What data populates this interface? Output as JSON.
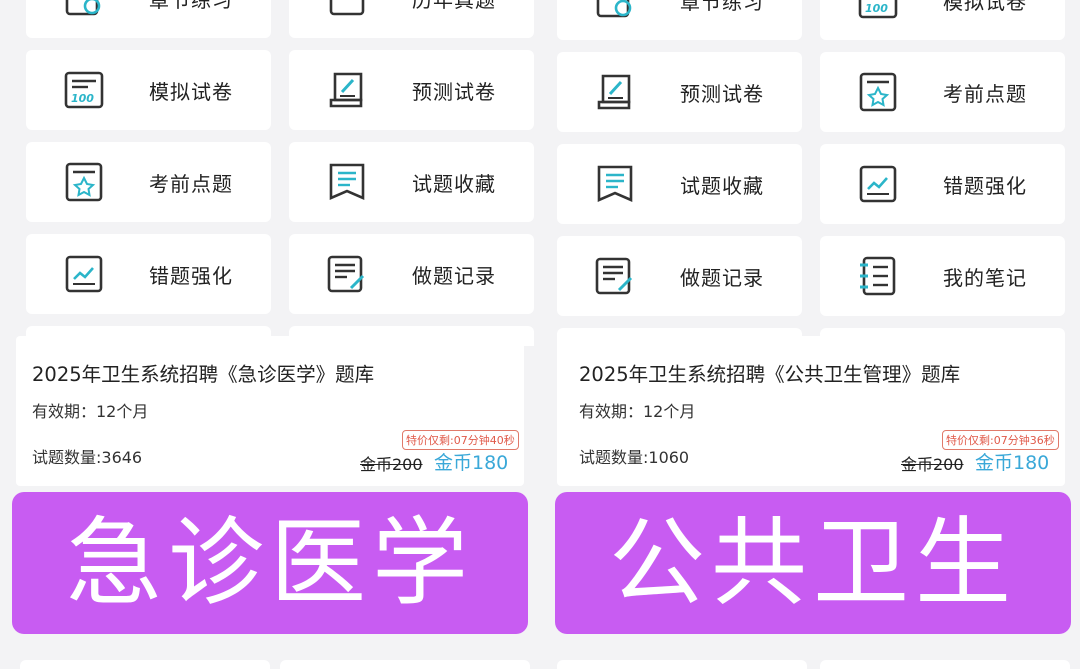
{
  "left": {
    "tiles": [
      {
        "label": "章节练习",
        "icon": "chapter-practice-icon"
      },
      {
        "label": "历年真题",
        "icon": "past-exams-icon"
      },
      {
        "label": "模拟试卷",
        "icon": "mock-exam-icon"
      },
      {
        "label": "预测试卷",
        "icon": "predicted-exam-icon"
      },
      {
        "label": "考前点题",
        "icon": "pre-exam-tips-icon"
      },
      {
        "label": "试题收藏",
        "icon": "favorites-icon"
      },
      {
        "label": "错题强化",
        "icon": "wrong-questions-icon"
      },
      {
        "label": "做题记录",
        "icon": "practice-record-icon"
      }
    ],
    "card": {
      "title": "2025年卫生系统招聘《急诊医学》题库",
      "validity": "有效期：12个月",
      "count": "试题数量:3646",
      "countdown": "特价仅剩:07分钟40秒",
      "original_price": "金币200",
      "price": "金币180"
    },
    "banner": "急诊医学"
  },
  "right": {
    "tiles": [
      {
        "label": "章节练习",
        "icon": "chapter-practice-icon"
      },
      {
        "label": "模拟试卷",
        "icon": "mock-exam-icon"
      },
      {
        "label": "预测试卷",
        "icon": "predicted-exam-icon"
      },
      {
        "label": "考前点题",
        "icon": "pre-exam-tips-icon"
      },
      {
        "label": "试题收藏",
        "icon": "favorites-icon"
      },
      {
        "label": "错题强化",
        "icon": "wrong-questions-icon"
      },
      {
        "label": "做题记录",
        "icon": "practice-record-icon"
      },
      {
        "label": "我的笔记",
        "icon": "notes-icon"
      }
    ],
    "card": {
      "title": "2025年卫生系统招聘《公共卫生管理》题库",
      "validity": "有效期：12个月",
      "count": "试题数量:1060",
      "countdown": "特价仅剩:07分钟36秒",
      "original_price": "金币200",
      "price": "金币180"
    },
    "banner": "公共卫生"
  },
  "colors": {
    "accent": "#3aa8d8",
    "banner": "#c85cf2",
    "icon_teal": "#2bb5c9",
    "sale": "#e05a4a"
  }
}
